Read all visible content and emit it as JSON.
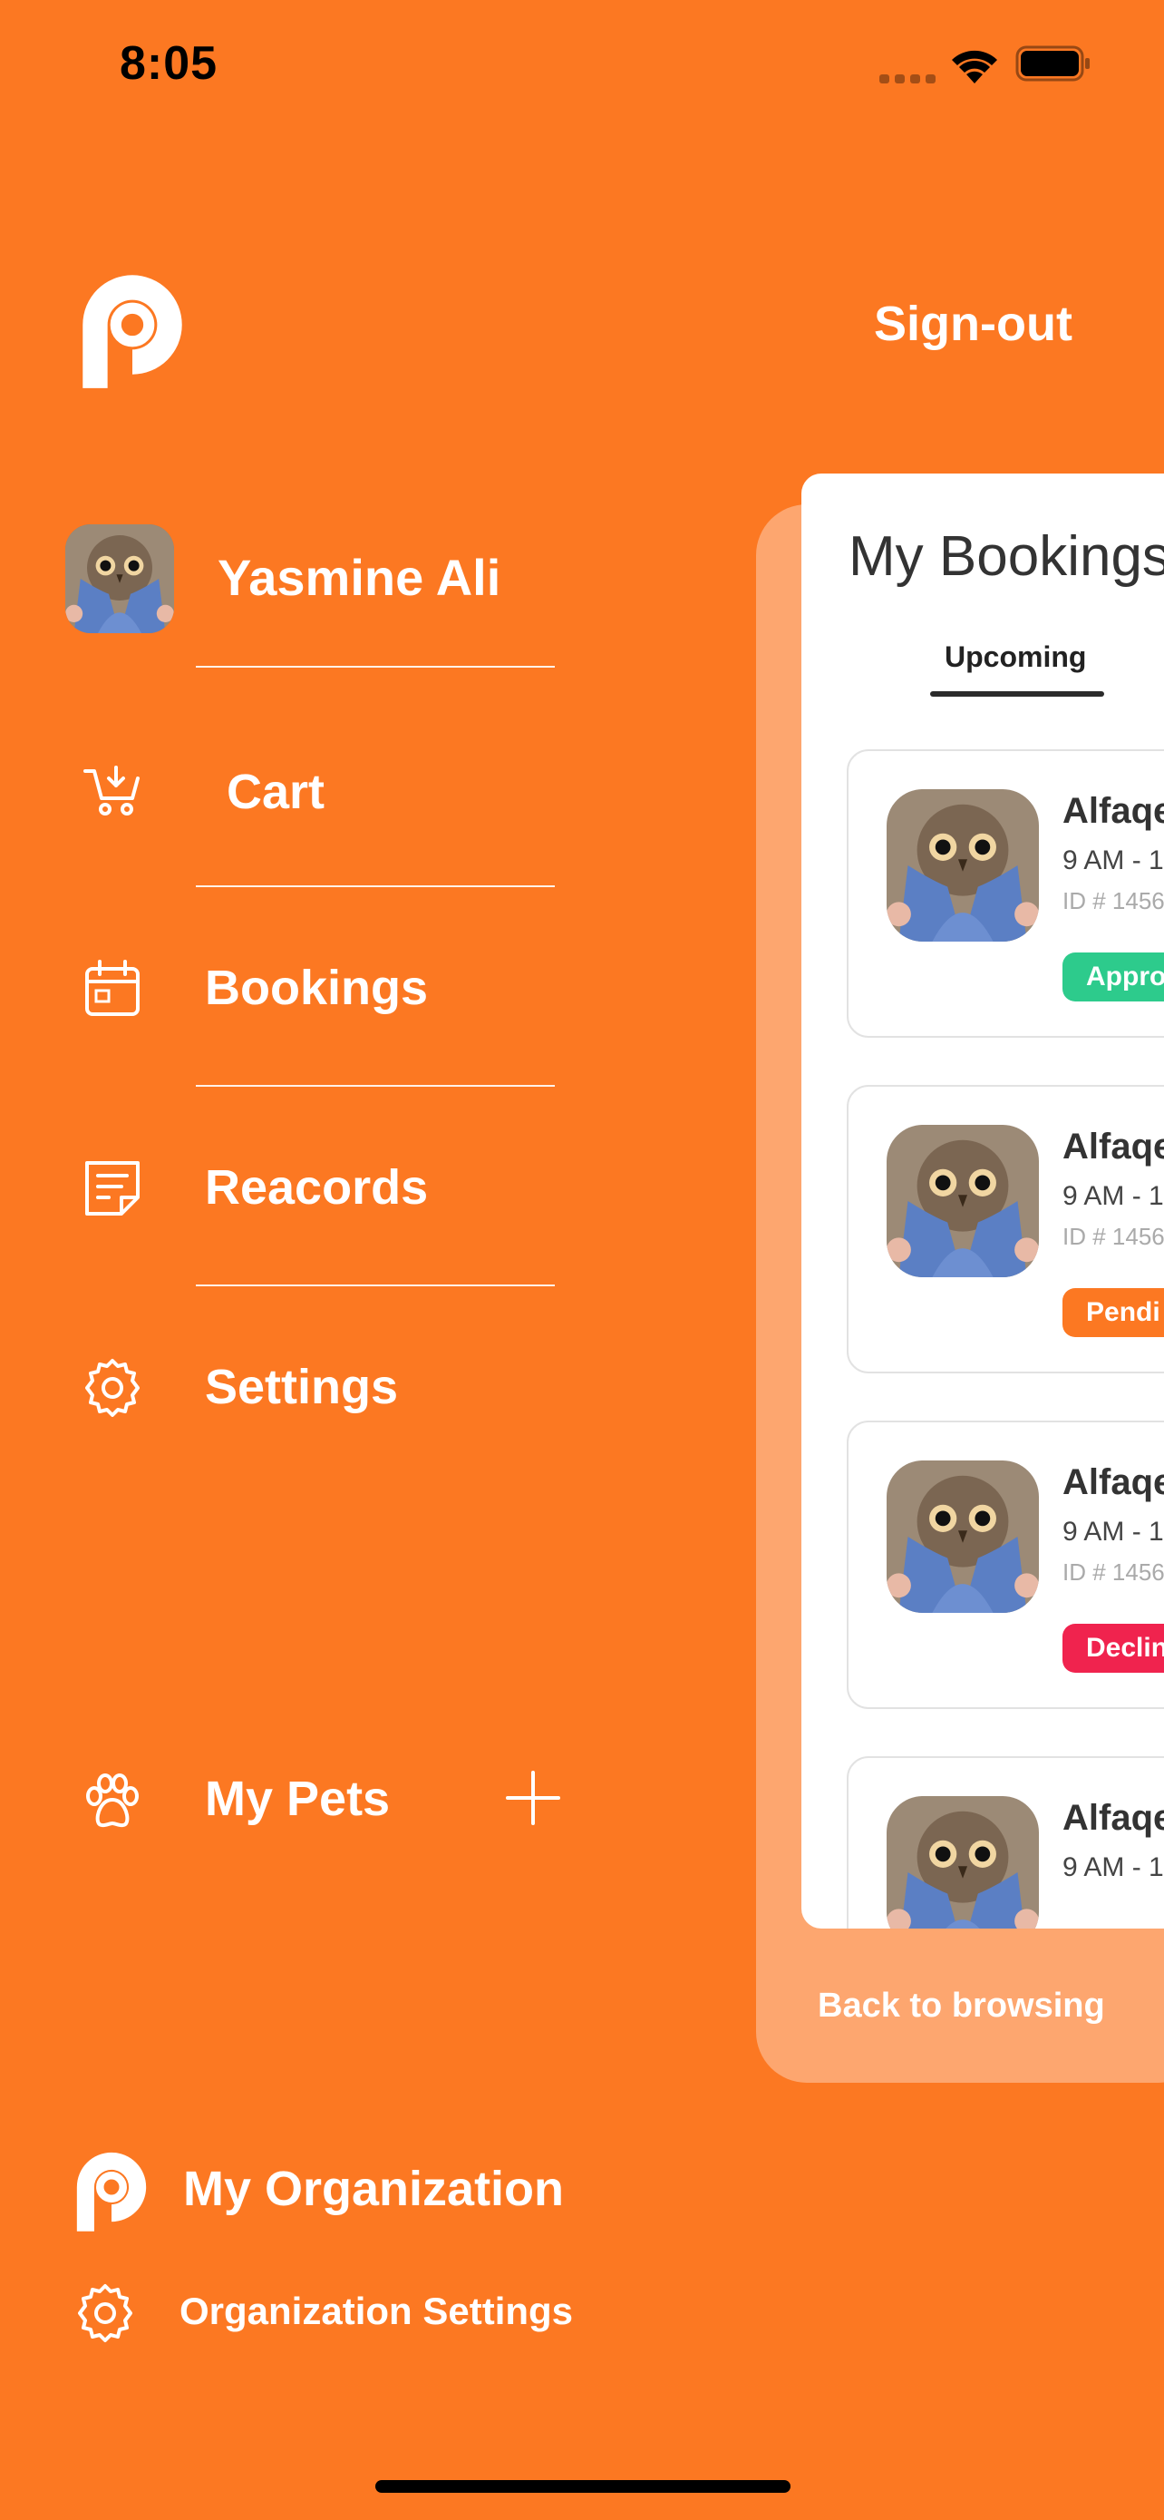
{
  "status_bar": {
    "time": "8:05"
  },
  "header": {
    "signout_label": "Sign-out"
  },
  "user": {
    "name": "Yasmine Ali"
  },
  "menu": {
    "cart": "Cart",
    "bookings": "Bookings",
    "records": "Reacords",
    "settings": "Settings",
    "pets": "My Pets"
  },
  "panel": {
    "title": "My Bookings",
    "tab": "Upcoming",
    "bookings": [
      {
        "title": "Alfaqe",
        "time": "9 AM - 1",
        "id": "ID # 1456",
        "status": "Appro",
        "status_color": "#2DCB8C"
      },
      {
        "title": "Alfaqe",
        "time": "9 AM - 1",
        "id": "ID # 1456",
        "status": "Pendi",
        "status_color": "#FC7822"
      },
      {
        "title": "Alfaqe",
        "time": "9 AM - 1",
        "id": "ID # 1456",
        "status": "Declin",
        "status_color": "#F0234E"
      },
      {
        "title": "Alfaqe",
        "time": "9 AM - 1"
      }
    ],
    "back_label": "Back to browsing"
  },
  "organization": {
    "name": "My Organization",
    "settings_label": "Organization Settings"
  },
  "colors": {
    "brand": "#FC7822",
    "panel": "#FDA66F",
    "approved": "#2DCB8C",
    "pending": "#FC7822",
    "declined": "#F0234E"
  }
}
